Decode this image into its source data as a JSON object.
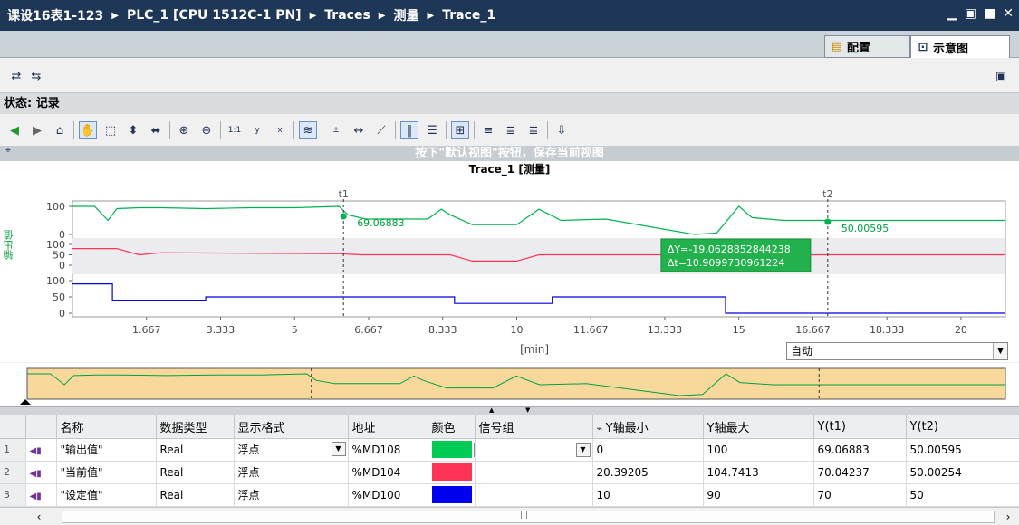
{
  "breadcrumb": [
    "课设16表1-123",
    "PLC_1 [CPU 1512C-1 PN]",
    "Traces",
    "测量",
    "Trace_1"
  ],
  "window_controls": [
    "▁",
    "▣",
    "■",
    "✕"
  ],
  "tabs": {
    "config": "配置",
    "diagram": "示意图"
  },
  "status": "状态: 记录",
  "hint": "按下\"默认视图\"按钮，保存当前视图",
  "chart": {
    "title": "Trace_1 [测量]",
    "ylabel": "输出值",
    "xlabel": "[min]",
    "cursor_t1": "t1",
    "cursor_t2": "t2",
    "cursor_t1_value": "69.06883",
    "cursor_t2_value": "50.00595",
    "delta_y": "ΔY=-19.0628852844238",
    "delta_t": "Δt=10.9099730961224",
    "x_ticks": [
      "1.667",
      "3.333",
      "5",
      "6.667",
      "8.333",
      "10",
      "11.667",
      "13.333",
      "15",
      "16.667",
      "18.333",
      "20"
    ],
    "y_ticks_output": [
      "100",
      "0"
    ],
    "y_ticks_current": [
      "100",
      "50",
      "0"
    ],
    "y_ticks_setpoint": [
      "100",
      "50",
      "0"
    ],
    "zoom_mode": "自动"
  },
  "chart_data": {
    "type": "line",
    "xlabel": "[min]",
    "ylabel": "输出值",
    "xlim": [
      0,
      21
    ],
    "series": [
      {
        "name": "输出值",
        "color": "#00b050",
        "ylim": [
          0,
          100
        ],
        "x": [
          0,
          0.5,
          0.8,
          1.0,
          1.5,
          2.0,
          3.0,
          4.0,
          5.0,
          6.0,
          6.2,
          6.6,
          8.0,
          8.3,
          8.5,
          9.0,
          10.0,
          10.5,
          11.0,
          12.0,
          14.0,
          14.5,
          15.0,
          15.3,
          16.0,
          17.0,
          21.0
        ],
        "y": [
          100,
          100,
          50,
          92,
          95,
          95,
          92,
          95,
          95,
          100,
          70,
          55,
          55,
          90,
          70,
          35,
          35,
          90,
          50,
          55,
          0,
          5,
          100,
          60,
          50,
          50,
          50
        ]
      },
      {
        "name": "当前值",
        "color": "#ff3355",
        "ylim": [
          0,
          100
        ],
        "x": [
          0,
          1.0,
          1.5,
          2.0,
          6.0,
          6.5,
          8.5,
          9.0,
          10.0,
          10.5,
          14.0,
          14.5,
          15.0,
          15.5,
          21.0
        ],
        "y": [
          80,
          80,
          50,
          60,
          55,
          50,
          50,
          20,
          20,
          50,
          50,
          10,
          10,
          50,
          50
        ]
      },
      {
        "name": "设定值",
        "color": "#0000dd",
        "ylim": [
          0,
          100
        ],
        "x": [
          0,
          0.9,
          0.9,
          3.0,
          3.0,
          8.6,
          8.6,
          10.8,
          10.8,
          14.7,
          14.7,
          21.0
        ],
        "y": [
          90,
          90,
          40,
          40,
          50,
          50,
          30,
          30,
          50,
          50,
          0,
          0
        ]
      }
    ]
  },
  "table": {
    "headers": [
      "名称",
      "数据类型",
      "显示格式",
      "地址",
      "颜色",
      "信号组",
      "Y轴最小",
      "Y轴最大",
      "Y(t1)",
      "Y(t2)"
    ],
    "rows": [
      {
        "num": "1",
        "name": "\"输出值\"",
        "type": "Real",
        "format": "浮点",
        "address": "%MD108",
        "color": "#00cc55",
        "ymin": "0",
        "ymax": "100",
        "yt1": "69.06883",
        "yt2": "50.00595"
      },
      {
        "num": "2",
        "name": "\"当前值\"",
        "type": "Real",
        "format": "浮点",
        "address": "%MD104",
        "color": "#ff3355",
        "ymin": "20.39205",
        "ymax": "104.7413",
        "yt1": "70.04237",
        "yt2": "50.00254"
      },
      {
        "num": "3",
        "name": "\"设定值\"",
        "type": "Real",
        "format": "浮点",
        "address": "%MD100",
        "color": "#0000ee",
        "ymin": "10",
        "ymax": "90",
        "yt1": "70",
        "yt2": "50"
      }
    ]
  },
  "scroll_center": "|||"
}
